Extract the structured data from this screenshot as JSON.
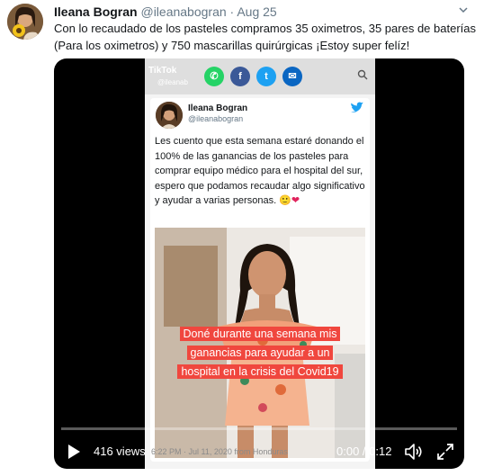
{
  "tweet": {
    "name": "Ileana Bogran",
    "handle": "@ileanabogran",
    "separator": "·",
    "date": "Aug 25",
    "text": "Con lo recaudado de los pasteles compramos 35 oximetros, 35 pares de baterías (Para los oximetros) y 750 mascarillas quirúrgicas  ¡Estoy super  felíz!"
  },
  "video": {
    "app": {
      "brand": "TikTok",
      "handle": "@ileanab"
    },
    "share_icons": [
      {
        "name": "whatsapp",
        "color": "#25d366",
        "glyph": "✆"
      },
      {
        "name": "facebook",
        "color": "#3b5998",
        "glyph": "f"
      },
      {
        "name": "twitter",
        "color": "#1da1f2",
        "glyph": "t"
      },
      {
        "name": "email",
        "color": "#0a66c2",
        "glyph": "✉"
      }
    ],
    "embedded_tweet": {
      "name": "Ileana Bogran",
      "handle": "@ileanabogran",
      "text": "Les cuento que esta semana estaré donando el 100% de las ganancias de los pasteles para comprar equipo médico para el hospital del sur, espero que podamos recaudar algo significativo  y ayudar a varias personas. 🙂",
      "emoji_heart": "❤"
    },
    "caption": "Doné durante una semana mis ganancias para ayudar a un hospital en la crisis del Covid19",
    "ghost_meta": "6:22 PM · Jul 11, 2020 from Honduras",
    "views": "416 views",
    "time": "0:00 / 0:12",
    "progress_fraction": 0.0
  },
  "colors": {
    "name": "#14171a",
    "meta": "#657786",
    "caption_bg": "#f0473e",
    "twitter_blue": "#1da1f2"
  }
}
